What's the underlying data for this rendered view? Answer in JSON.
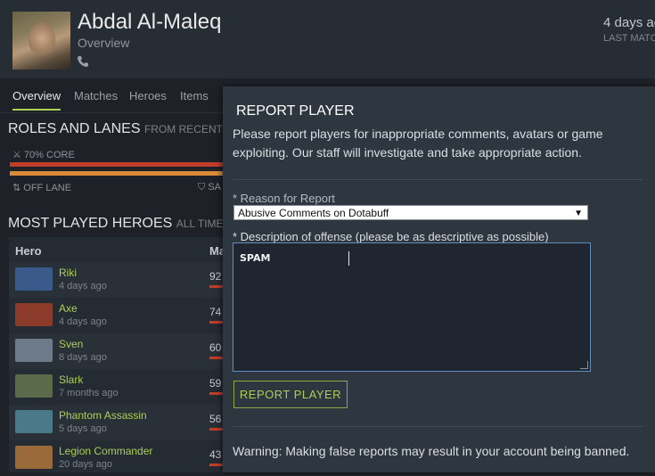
{
  "profile": {
    "name": "Abdal Al-Maleq",
    "subtitle": "Overview",
    "last_match_ago": "4 days ag",
    "last_match_label": "LAST MATC"
  },
  "tabs": [
    {
      "label": "Overview",
      "active": true
    },
    {
      "label": "Matches",
      "active": false
    },
    {
      "label": "Heroes",
      "active": false
    },
    {
      "label": "Items",
      "active": false
    }
  ],
  "roles": {
    "title": "ROLES AND LANES",
    "subtitle": "FROM RECENTLY A",
    "core_label": "70% CORE",
    "lane_label": "OFF LANE",
    "lane_label_2": "SA"
  },
  "most_played": {
    "title": "MOST PLAYED HEROES",
    "subtitle": "ALL TIME",
    "col_hero": "Hero",
    "col_matches": "Ma",
    "rows": [
      {
        "name": "Riki",
        "ago": "4 days ago",
        "matches": "92",
        "icon_color": "#3a5a8c"
      },
      {
        "name": "Axe",
        "ago": "4 days ago",
        "matches": "74",
        "icon_color": "#8c3a2a"
      },
      {
        "name": "Sven",
        "ago": "8 days ago",
        "matches": "60",
        "icon_color": "#6c7a8a"
      },
      {
        "name": "Slark",
        "ago": "7 months ago",
        "matches": "59",
        "icon_color": "#5a6a4a"
      },
      {
        "name": "Phantom Assassin",
        "ago": "5 days ago",
        "matches": "56",
        "icon_color": "#4a7a8a"
      },
      {
        "name": "Legion Commander",
        "ago": "20 days ago",
        "matches": "43",
        "icon_color": "#9a6a3a"
      }
    ]
  },
  "modal": {
    "title": "REPORT PLAYER",
    "description": "Please report players for inappropriate comments, avatars or game exploiting. Our staff will investigate and take appropriate action.",
    "reason_label": "* Reason for Report",
    "reason_value": "Abusive Comments on Dotabuff",
    "offense_label": "* Description of offense (please be as descriptive as possible)",
    "offense_value": "SPAM",
    "submit_label": "REPORT PLAYER",
    "warning": "Warning: Making false reports may result in your account being banned."
  }
}
